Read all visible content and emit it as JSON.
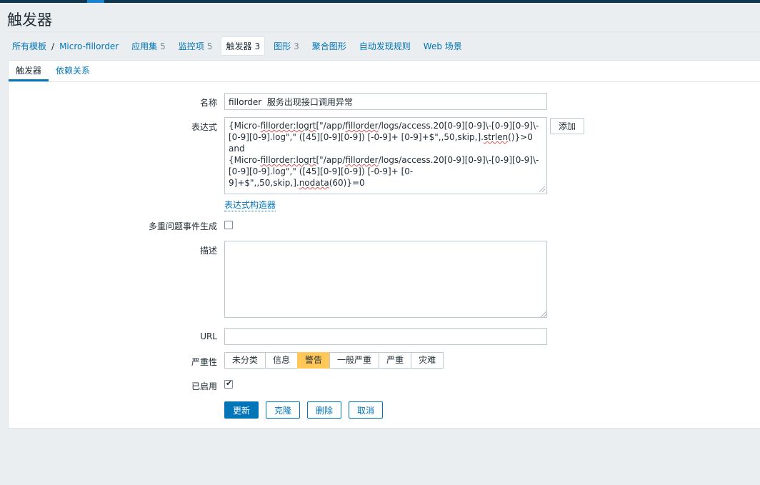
{
  "page_title": "触发器",
  "breadcrumb": {
    "all_templates": "所有模板",
    "separator": "/",
    "template_name": "Micro-fillorder"
  },
  "nav_tabs": [
    {
      "label": "应用集",
      "count": "5"
    },
    {
      "label": "监控项",
      "count": "5"
    },
    {
      "label": "触发器",
      "count": "3"
    },
    {
      "label": "图形",
      "count": "3"
    },
    {
      "label": "聚合图形",
      "count": ""
    },
    {
      "label": "自动发现规则",
      "count": ""
    },
    {
      "label": "Web 场景",
      "count": ""
    }
  ],
  "sub_tabs": {
    "trigger": "触发器",
    "dependencies": "依赖关系"
  },
  "form": {
    "name_label": "名称",
    "name_value": "fillorder  服务出现接口调用异常",
    "expression_label": "表达式",
    "expression_parts": {
      "p1": "{Micro-",
      "p2": "fillorder:logrt",
      "p3": "[\"/app/",
      "p4": "fillorder",
      "p5": "/logs/access.20[0-9][0-9]\\-[0-9][0-9]\\-[0-9][0-9].log\",\" ([45][0-9][0-9]) [-0-9]+ [0-9]+$\",,50,skip,].",
      "p6": "strlen",
      "p7": "()}>0",
      "p8": "and",
      "p9": "{Micro-",
      "p10": "fillorder:logrt",
      "p11": "[\"/app/",
      "p12": "fillorder",
      "p13": "/logs/access.20[0-9][0-9]\\-[0-9][0-9]\\-[0-9][0-9].log\",\" ([45][0-9][0-9]) [-0-9]+ [0-9]+$\",,50,skip,].",
      "p14": "nodata",
      "p15": "(60)}=0"
    },
    "add_button": "添加",
    "expression_builder_link": "表达式构造器",
    "multiple_events_label": "多重问题事件生成",
    "multiple_events_checked": false,
    "description_label": "描述",
    "description_value": "",
    "url_label": "URL",
    "url_value": "",
    "severity_label": "严重性",
    "severity_options": [
      "未分类",
      "信息",
      "警告",
      "一般严重",
      "严重",
      "灾难"
    ],
    "severity_selected": "警告",
    "enabled_label": "已启用",
    "enabled_checked": true
  },
  "buttons": {
    "update": "更新",
    "clone": "克隆",
    "delete": "删除",
    "cancel": "取消"
  },
  "colors": {
    "primary": "#0275b8",
    "severity_warning": "#ffc859",
    "topbar": "#0f3551"
  }
}
